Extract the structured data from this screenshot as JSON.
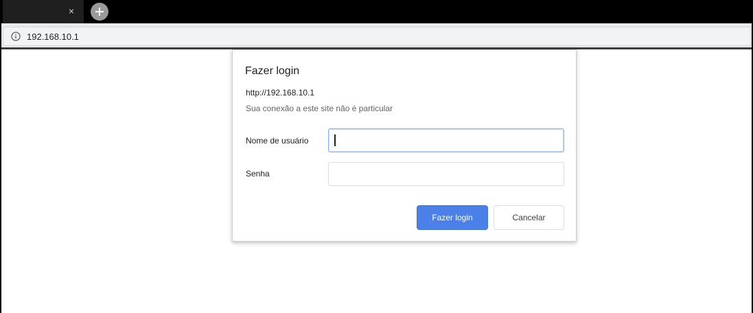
{
  "browser": {
    "tab": {
      "close_glyph": "×",
      "close_icon": "close-icon"
    },
    "new_tab": {
      "icon": "plus-icon"
    },
    "address_bar": {
      "icon": "info-icon",
      "url": "192.168.10.1"
    }
  },
  "dialog": {
    "title": "Fazer login",
    "site_url": "http://192.168.10.1",
    "warning": "Sua conexão a este site não é particular",
    "username": {
      "label": "Nome de usuário",
      "value": "",
      "placeholder": ""
    },
    "password": {
      "label": "Senha",
      "value": "",
      "placeholder": ""
    },
    "buttons": {
      "login": "Fazer login",
      "cancel": "Cancelar"
    }
  },
  "colors": {
    "primary_button": "#4a80e8",
    "focus_border": "#8ab4f8"
  }
}
